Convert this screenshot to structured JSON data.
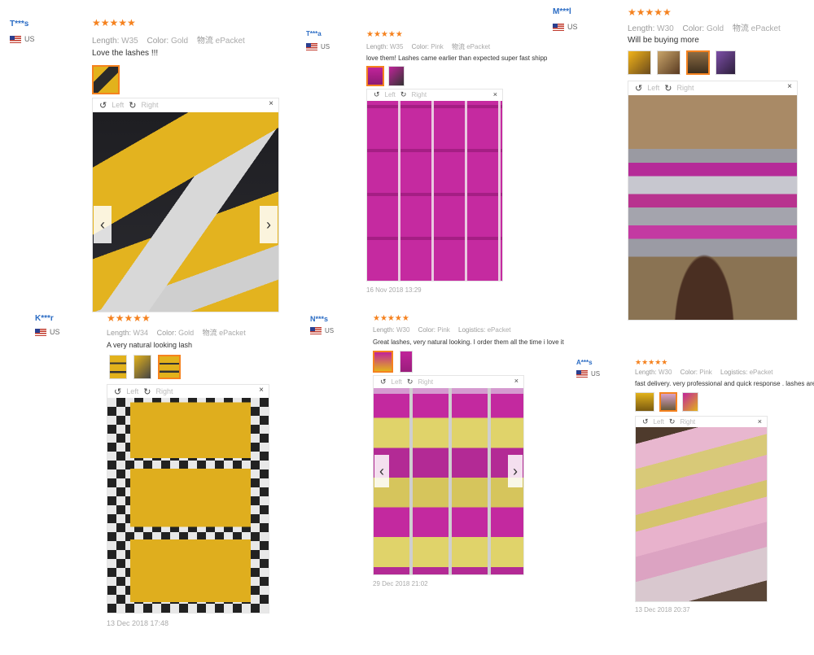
{
  "reviews": [
    {
      "user": "T***s",
      "country": "US",
      "stars": "★★★★★",
      "length_label": "Length:",
      "length": "W35",
      "color_label": "Color:",
      "color": "Gold",
      "shipping_label": "物流",
      "shipping": "ePacket",
      "text": "Love the lashes !!!",
      "left": "Left",
      "right": "Right",
      "close": "×",
      "date": ""
    },
    {
      "user": "T***a",
      "country": "US",
      "stars": "★★★★★",
      "length_label": "Length:",
      "length": "W35",
      "color_label": "Color:",
      "color": "Pink",
      "shipping_label": "物流",
      "shipping": "ePacket",
      "text": "love them! Lashes came earlier than expected super fast shipp",
      "left": "Left",
      "right": "Right",
      "close": "×",
      "date": "16 Nov 2018 13:29"
    },
    {
      "user": "M***l",
      "country": "US",
      "stars": "★★★★★",
      "length_label": "Length:",
      "length": "W30",
      "color_label": "Color:",
      "color": "Gold",
      "shipping_label": "物流",
      "shipping": "ePacket",
      "text": "Will be buying more",
      "left": "Left",
      "right": "Right",
      "close": "×",
      "date": ""
    },
    {
      "user": "K***r",
      "country": "US",
      "stars": "★★★★★",
      "length_label": "Length:",
      "length": "W34",
      "color_label": "Color:",
      "color": "Gold",
      "shipping_label": "物流",
      "shipping": "ePacket",
      "text": "A very natural looking lash",
      "left": "Left",
      "right": "Right",
      "close": "×",
      "date": "13 Dec 2018 17:48"
    },
    {
      "user": "N***s",
      "country": "US",
      "stars": "★★★★★",
      "length_label": "Length:",
      "length": "W30",
      "color_label": "Color:",
      "color": "Pink",
      "shipping_label": "Logistics:",
      "shipping": "ePacket",
      "text": "Great lashes, very natural looking. I order them all the time i love it",
      "left": "Left",
      "right": "Right",
      "close": "×",
      "date": "29 Dec 2018 21:02"
    },
    {
      "user": "A***s",
      "country": "US",
      "stars": "★★★★★",
      "length_label": "Length:",
      "length": "W30",
      "color_label": "Color:",
      "color": "Pink",
      "shipping_label": "Logistics:",
      "shipping": "ePacket",
      "text": "fast delivery. very professional and quick response . lashes are b",
      "left": "Left",
      "right": "Right",
      "close": "×",
      "date": "13 Dec 2018 20:37"
    }
  ],
  "icons": {
    "rotate_left": "rotate-left-icon",
    "rotate_right": "rotate-right-icon",
    "prev": "chevron-left-icon",
    "next": "chevron-right-icon",
    "flag": "us-flag-icon"
  },
  "colors": {
    "accent": "#f5821f",
    "username": "#2b6cc4",
    "gold_box": "#e2b21c",
    "pink_box": "#c0249a"
  }
}
